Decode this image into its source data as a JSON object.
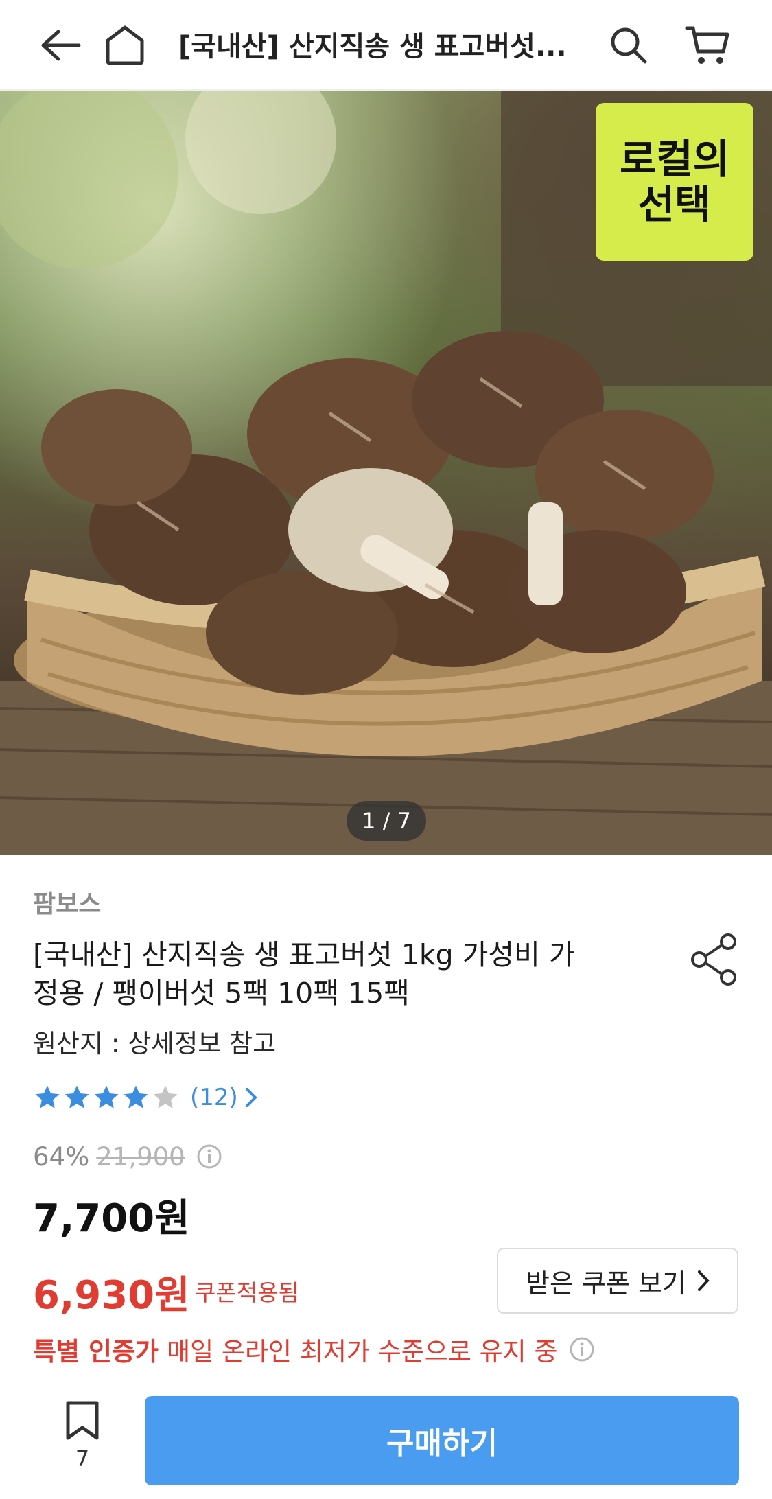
{
  "header": {
    "title": "[국내산] 산지직송 생 표고버섯...",
    "back_icon": "arrow-left-icon",
    "home_icon": "home-icon",
    "search_icon": "search-icon",
    "cart_icon": "cart-icon"
  },
  "hero": {
    "badge": "로컬의 선택",
    "pager": "1 / 7"
  },
  "product": {
    "seller": "팜보스",
    "title": "[국내산] 산지직송 생 표고버섯 1kg 가성비 가정용 / 팽이버섯 5팩 10팩 15팩",
    "origin": "원산지 : 상세정보 참고",
    "rating": 4,
    "rating_max": 5,
    "review_count": "(12)",
    "discount": "64%",
    "original_price": "21,900",
    "price": "7,700원",
    "coupon_price": "6,930원",
    "coupon_applied": "쿠폰적용됨",
    "coupon_button": "받은 쿠폰 보기",
    "promo_strong": "특별 인증가",
    "promo_text": "매일 온라인 최저가 수준으로 유지 중"
  },
  "bottom": {
    "bookmark_count": "7",
    "buy_label": "구매하기"
  },
  "colors": {
    "accent": "#4a9cf0",
    "sale": "#e03c31",
    "star_filled": "#3b8de0",
    "star_empty": "#c4c4c4",
    "badge": "#d5ec4a"
  }
}
